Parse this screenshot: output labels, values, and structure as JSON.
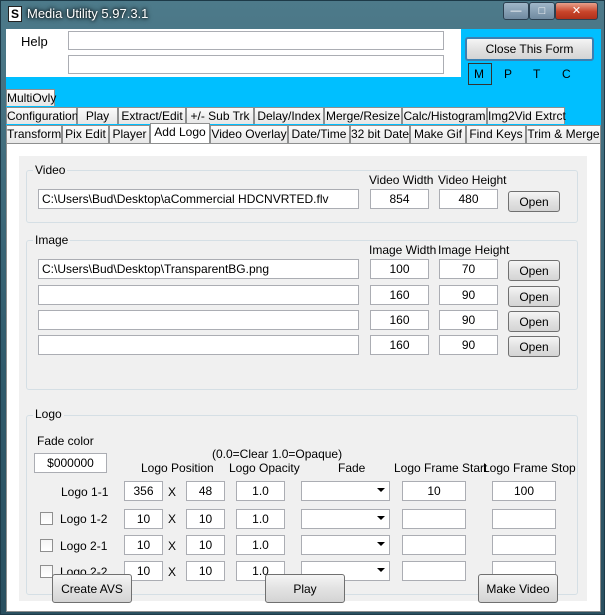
{
  "window": {
    "title": "Media Utility 5.97.3.1",
    "icon_glyph": "S"
  },
  "caption_buttons": {
    "minimize": "—",
    "maximize": "□",
    "close": "✕"
  },
  "header": {
    "help_label": "Help",
    "help_box1": "",
    "help_box2": "",
    "close_form_label": "Close This Form"
  },
  "mode_buttons": [
    "M",
    "P",
    "T",
    "C"
  ],
  "tabs_row1": [
    "MultiOvly"
  ],
  "tabs_row2": [
    "Configuration",
    "Play",
    "Extract/Edit",
    "+/- Sub Trk",
    "Delay/Index",
    "Merge/Resize",
    "Calc/Histogram",
    "Img2Vid Extrct"
  ],
  "tabs_row3": [
    "Transform",
    "Pix Edit",
    "Player",
    "Add Logo",
    "Video Overlay",
    "Date/Time",
    "32 bit Date",
    "Make Gif",
    "Find Keys",
    "Trim & Merge"
  ],
  "selected_tab": "Add Logo",
  "video": {
    "group_label": "Video",
    "width_label": "Video Width",
    "height_label": "Video Height",
    "path": "C:\\Users\\Bud\\Desktop\\aCommercial HDCNVRTED.flv",
    "width": "854",
    "height": "480",
    "open_label": "Open"
  },
  "image": {
    "group_label": "Image",
    "width_label": "Image Width",
    "height_label": "Image Height",
    "open_label": "Open",
    "rows": [
      {
        "path": "C:\\Users\\Bud\\Desktop\\TransparentBG.png",
        "width": "100",
        "height": "70"
      },
      {
        "path": "",
        "width": "160",
        "height": "90"
      },
      {
        "path": "",
        "width": "160",
        "height": "90"
      },
      {
        "path": "",
        "width": "160",
        "height": "90"
      }
    ]
  },
  "logo": {
    "group_label": "Logo",
    "fade_color_label": "Fade color",
    "fade_color_value": "$000000",
    "opacity_note": "(0.0=Clear  1.0=Opaque)",
    "col_position": "Logo Position",
    "col_opacity": "Logo Opacity",
    "col_fade": "Fade",
    "col_frame_start": "Logo Frame Start",
    "col_frame_stop": "Logo Frame Stop",
    "x_sep": "X",
    "rows": [
      {
        "label": "Logo 1-1",
        "checkbox": false,
        "x": "356",
        "y": "48",
        "opacity": "1.0",
        "fade": "",
        "start": "10",
        "stop": "100"
      },
      {
        "label": "Logo 1-2",
        "checkbox": true,
        "x": "10",
        "y": "10",
        "opacity": "1.0",
        "fade": "",
        "start": "",
        "stop": ""
      },
      {
        "label": "Logo 2-1",
        "checkbox": true,
        "x": "10",
        "y": "10",
        "opacity": "1.0",
        "fade": "",
        "start": "",
        "stop": ""
      },
      {
        "label": "Logo 2-2",
        "checkbox": true,
        "x": "10",
        "y": "10",
        "opacity": "1.0",
        "fade": "",
        "start": "",
        "stop": ""
      }
    ]
  },
  "footer": {
    "create_avs_label": "Create AVS",
    "play_label": "Play",
    "make_video_label": "Make Video"
  }
}
